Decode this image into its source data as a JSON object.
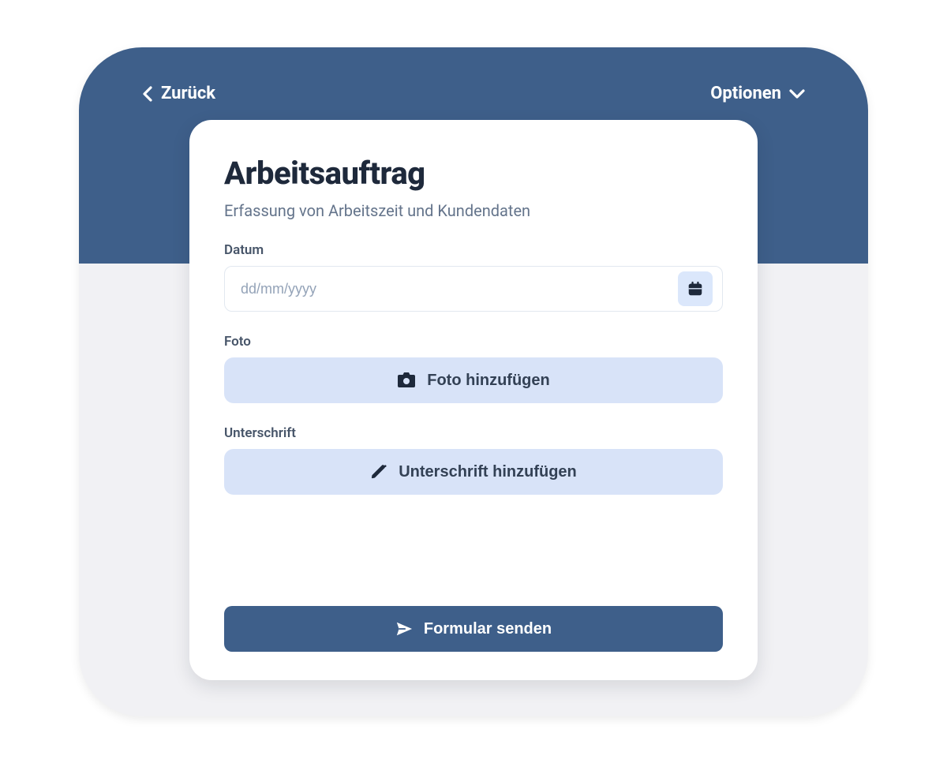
{
  "colors": {
    "brand": "#3e5f8a",
    "soft": "#d8e3f8",
    "chip": "#dbe7fb",
    "text_primary": "#1e293b",
    "text_muted": "#64748b"
  },
  "topbar": {
    "back_label": "Zurück",
    "options_label": "Optionen"
  },
  "form": {
    "title": "Arbeitsauftrag",
    "subtitle": "Erfassung von Arbeitszeit und Kundendaten",
    "date": {
      "label": "Datum",
      "placeholder": "dd/mm/yyyy",
      "value": ""
    },
    "photo": {
      "label": "Foto",
      "button_label": "Foto hinzufügen"
    },
    "signature": {
      "label": "Unterschrift",
      "button_label": "Unterschrift hinzufügen"
    },
    "submit_label": "Formular senden"
  }
}
